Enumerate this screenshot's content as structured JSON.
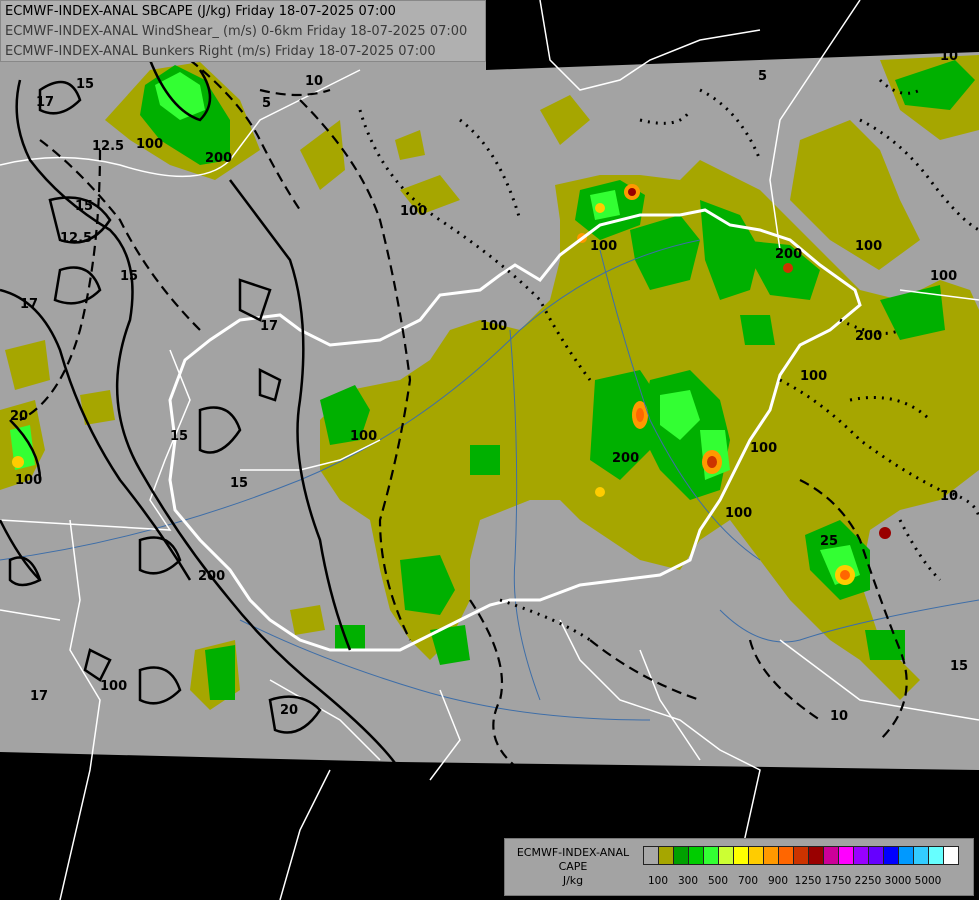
{
  "header": {
    "line1": "ECMWF-INDEX-ANAL SBCAPE (J/kg) Friday 18-07-2025 07:00",
    "line2": "ECMWF-INDEX-ANAL WindShear_ (m/s) 0-6km Friday 18-07-2025 07:00",
    "line3": "ECMWF-INDEX-ANAL Bunkers Right (m/s) Friday 18-07-2025 07:00"
  },
  "legend": {
    "title_line1": "ECMWF-INDEX-ANAL",
    "title_line2": "CAPE",
    "title_line3": "J/kg",
    "colors": [
      "#a8a8a8",
      "#a6a600",
      "#00a000",
      "#00cc00",
      "#33ff33",
      "#ccff33",
      "#ffff00",
      "#ffcc00",
      "#ff9900",
      "#ff6600",
      "#cc3300",
      "#990000",
      "#cc0099",
      "#ff00ff",
      "#9900ff",
      "#6600ff",
      "#0000ff",
      "#0099ff",
      "#33ccff",
      "#66ffff",
      "#ffffff"
    ],
    "tick_labels": [
      "100",
      "300",
      "500",
      "700",
      "900",
      "1250",
      "1750",
      "2250",
      "3000",
      "5000"
    ]
  },
  "map": {
    "contour_labels": [
      "17",
      "15",
      "12.5",
      "10",
      "5",
      "12.5",
      "17",
      "15",
      "20",
      "17",
      "15",
      "15",
      "17",
      "20",
      "10",
      "15",
      "100",
      "200",
      "100",
      "100",
      "200",
      "100",
      "200",
      "100",
      "100",
      "100",
      "200",
      "100",
      "200",
      "100",
      "100",
      "10",
      "25",
      "10",
      "15",
      "5",
      "100",
      "100"
    ]
  }
}
